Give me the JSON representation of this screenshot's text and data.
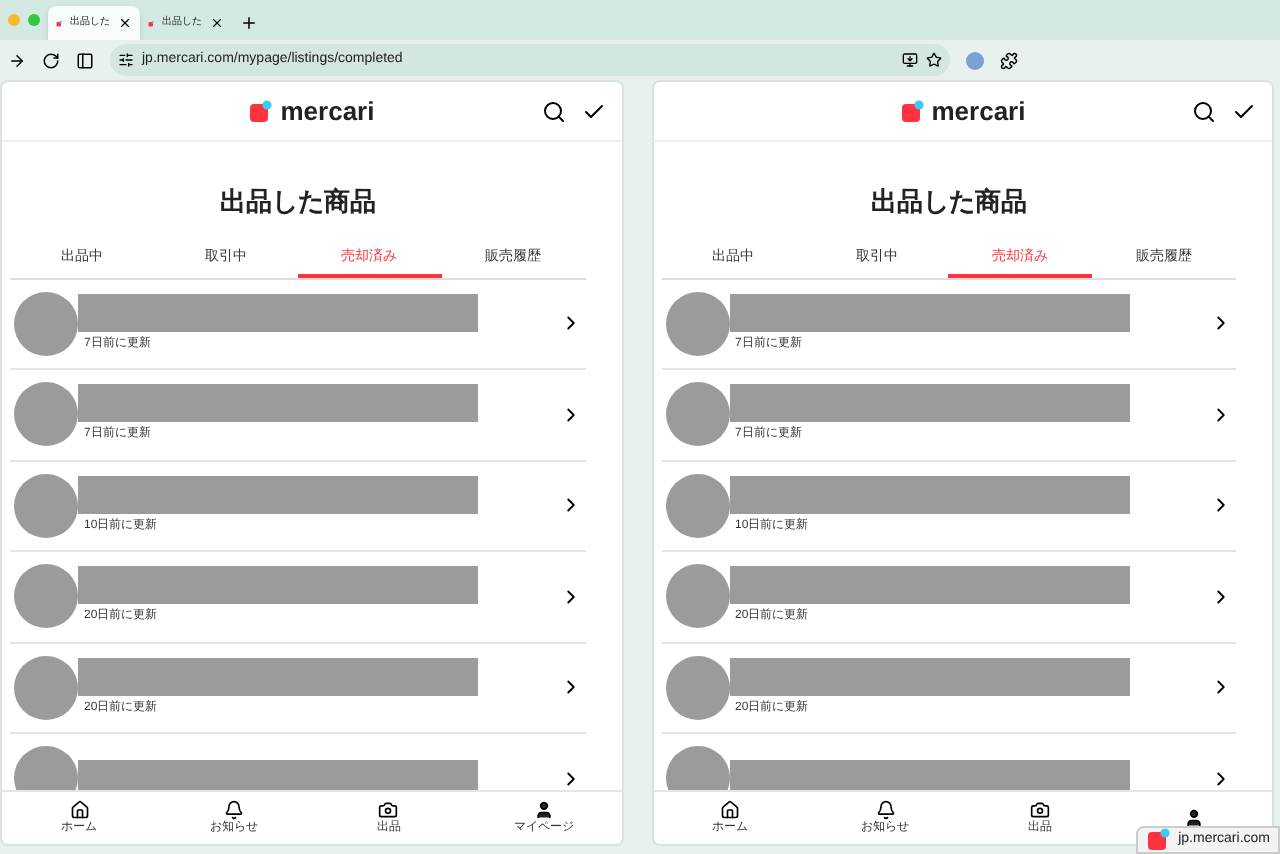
{
  "browser": {
    "tabs": [
      {
        "title": "出品した",
        "selected": true
      },
      {
        "title": "出品した",
        "selected": false
      }
    ],
    "url": "jp.mercari.com/mypage/listings/completed"
  },
  "panes": [
    {
      "logo": "mercari",
      "title": "出品した商品",
      "tabs": [
        {
          "label": "出品中",
          "selected": false
        },
        {
          "label": "取引中",
          "selected": false
        },
        {
          "label": "売却済み",
          "selected": true
        },
        {
          "label": "販売履歴",
          "selected": false
        }
      ],
      "items": [
        {
          "kind": "listing",
          "updated": "7日前に更新"
        },
        {
          "kind": "listing",
          "updated": "7日前に更新"
        },
        {
          "kind": "listing",
          "updated": "10日前に更新"
        },
        {
          "kind": "listing",
          "updated": "20日前に更新"
        },
        {
          "kind": "listing",
          "updated": "20日前に更新"
        },
        {
          "kind": "listing"
        }
      ],
      "nav": [
        {
          "label": "ホーム",
          "kind": "home"
        },
        {
          "label": "お知らせ",
          "kind": "bell"
        },
        {
          "label": "出品",
          "kind": "camera"
        },
        {
          "label": "マイページ",
          "kind": "user"
        }
      ]
    },
    {
      "logo": "mercari",
      "title": "出品した商品",
      "tabs": [
        {
          "label": "出品中",
          "selected": false
        },
        {
          "label": "取引中",
          "selected": false
        },
        {
          "label": "売却済み",
          "selected": true
        },
        {
          "label": "販売履歴",
          "selected": false
        }
      ],
      "items": [
        {
          "kind": "listing",
          "updated": "7日前に更新"
        },
        {
          "kind": "listing",
          "updated": "7日前に更新"
        },
        {
          "kind": "listing",
          "updated": "10日前に更新"
        },
        {
          "kind": "listing",
          "updated": "20日前に更新"
        },
        {
          "kind": "listing",
          "updated": "20日前に更新"
        },
        {
          "kind": "listing"
        }
      ],
      "nav": [
        {
          "label": "ホーム",
          "kind": "home"
        },
        {
          "label": "お知らせ",
          "kind": "bell"
        },
        {
          "label": "出品",
          "kind": "camera"
        },
        {
          "kind": "user"
        }
      ]
    }
  ],
  "status_url": "jp.mercari.com"
}
